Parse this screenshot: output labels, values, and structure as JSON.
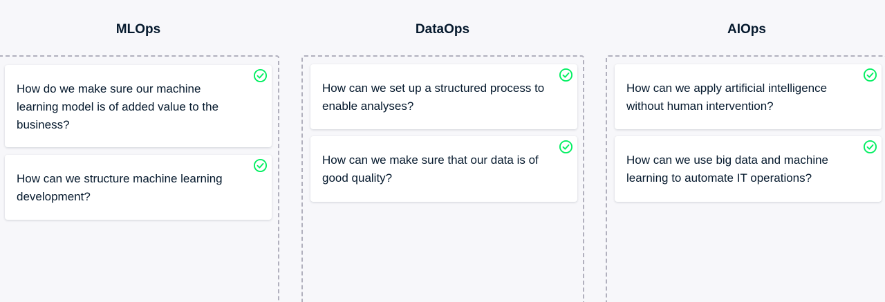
{
  "colors": {
    "background": "#f7f7fa",
    "text": "#05192d",
    "card": "#ffffff",
    "dashed_border": "#b1b0bd",
    "check": "#03ef62"
  },
  "columns": [
    {
      "title": "MLOps",
      "cards": [
        {
          "text": "How do we make sure our machine learning model is of added value to the business?",
          "icon": "check-circle-icon"
        },
        {
          "text": "How can we structure machine learning development?",
          "icon": "check-circle-icon"
        }
      ]
    },
    {
      "title": "DataOps",
      "cards": [
        {
          "text": "How can we set up a structured process to enable analyses?",
          "icon": "check-circle-icon"
        },
        {
          "text": "How can we make sure that our data is of good quality?",
          "icon": "check-circle-icon"
        }
      ]
    },
    {
      "title": "AIOps",
      "cards": [
        {
          "text": "How can we apply artificial intelligence without human intervention?",
          "icon": "check-circle-icon"
        },
        {
          "text": "How can we use big data and machine learning to automate IT operations?",
          "icon": "check-circle-icon"
        }
      ]
    }
  ]
}
